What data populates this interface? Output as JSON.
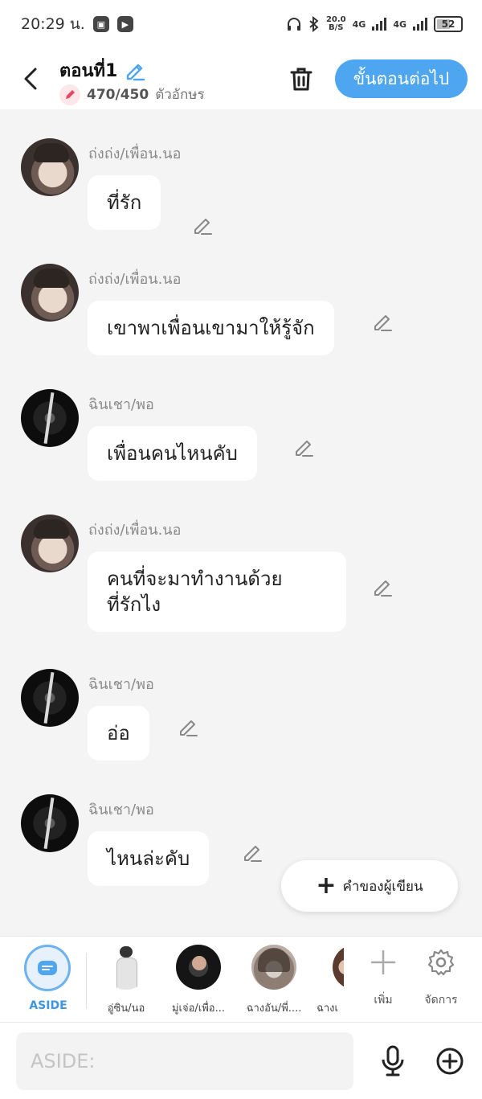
{
  "status_bar": {
    "time": "20:29 น.",
    "net_speed_value": "20.0",
    "net_speed_unit": "B/S",
    "network_1": "4G",
    "network_2": "4G",
    "battery": "52"
  },
  "header": {
    "title": "ตอนที่1",
    "char_count": "470/450",
    "char_count_unit": "ตัวอักษร",
    "next_button": "ขั้นตอนต่อไป"
  },
  "messages": [
    {
      "sender": "ถ่งถ่ง/เพื่อน.นอ",
      "text": "ที่รัก",
      "avatar": "light"
    },
    {
      "sender": "ถ่งถ่ง/เพื่อน.นอ",
      "text": "เขาพาเพื่อนเขามาให้รู้จัก",
      "avatar": "light"
    },
    {
      "sender": "ฉินเชา/พอ",
      "text": "เพื่อนคนไหนคับ",
      "avatar": "dark"
    },
    {
      "sender": "ถ่งถ่ง/เพื่อน.นอ",
      "text_line1": "คนที่จะมาทำงานด้วย",
      "text_line2": "ที่รักไง",
      "avatar": "light"
    },
    {
      "sender": "ฉินเชา/พอ",
      "text": "อ่อ",
      "avatar": "dark"
    },
    {
      "sender": "ฉินเชา/พอ",
      "text": "ไหนล่ะคับ",
      "avatar": "dark"
    }
  ],
  "author_note_button": "คำของผู้เขียน",
  "character_bar": {
    "aside_label": "ASIDE",
    "characters": [
      {
        "name": "อู่ซิน/นอ"
      },
      {
        "name": "มู่เจ่อ/เพื่อ..."
      },
      {
        "name": "ฉางอัน/พี่...."
      },
      {
        "name": "ฉางเ"
      }
    ],
    "add_label": "เพิ่ม",
    "manage_label": "จัดการ"
  },
  "input_bar": {
    "placeholder": "ASIDE:"
  },
  "colors": {
    "accent": "#4fa6f0",
    "aside_blue": "#3d95e6",
    "badge_pink": "#e8475f",
    "background": "#f4f4f4"
  }
}
